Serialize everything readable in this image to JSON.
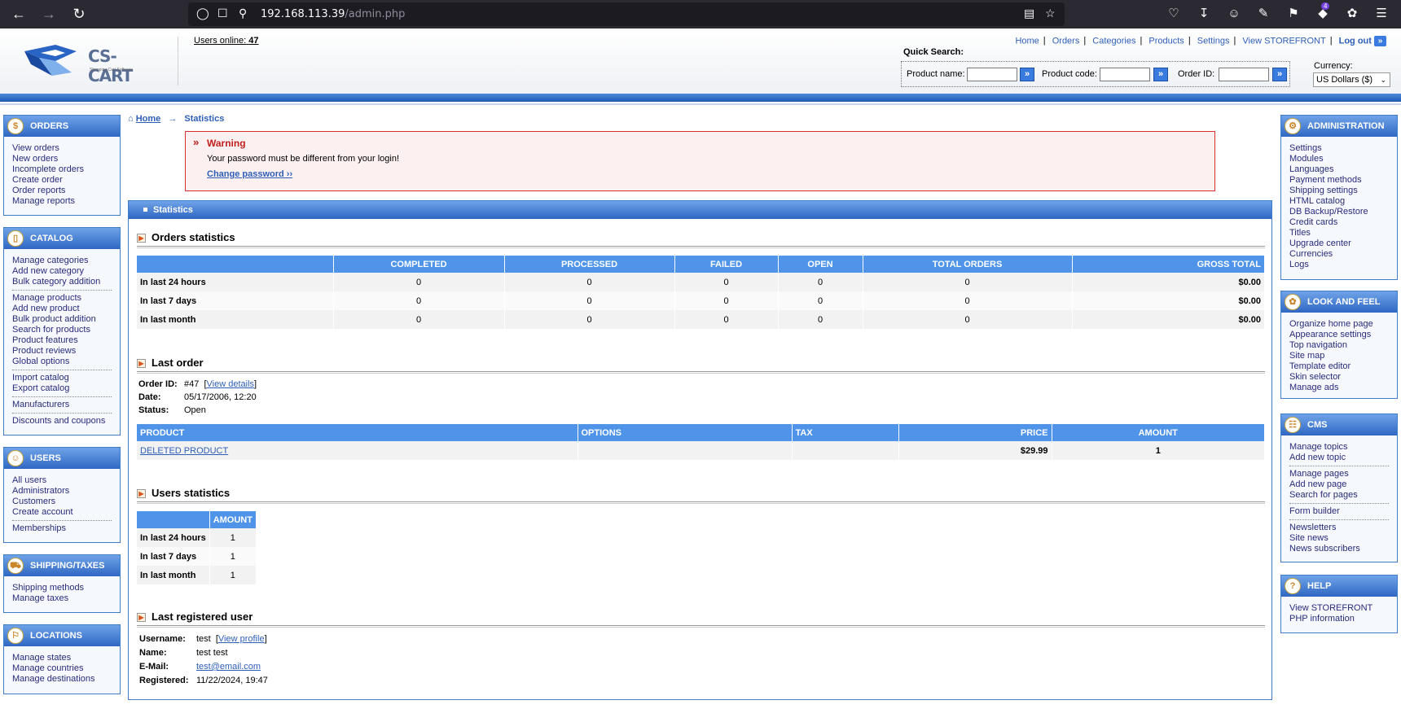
{
  "browser": {
    "url_host": "192.168.113.39",
    "url_path": "/admin.php",
    "extensions_badge": "4"
  },
  "header": {
    "logo_text": "CS-CART",
    "logo_tagline": "Shopping Cart Software",
    "users_online_label": "Users online:",
    "users_online_count": "47",
    "nav": [
      "Home",
      "Orders",
      "Categories",
      "Products",
      "Settings",
      "View STOREFRONT"
    ],
    "logout": "Log out",
    "quick_search": {
      "title": "Quick Search:",
      "product_name_label": "Product name:",
      "product_code_label": "Product code:",
      "order_id_label": "Order ID:"
    },
    "currency_label": "Currency:",
    "currency_value": "US Dollars ($)"
  },
  "left_sidebar": {
    "orders": {
      "title": "ORDERS",
      "items": [
        "View orders",
        "New orders",
        "Incomplete orders",
        "Create order",
        "Order reports",
        "Manage reports"
      ]
    },
    "catalog": {
      "title": "CATALOG",
      "groups": [
        [
          "Manage categories",
          "Add new category",
          "Bulk category addition"
        ],
        [
          "Manage products",
          "Add new product",
          "Bulk product addition",
          "Search for products",
          "Product features",
          "Product reviews",
          "Global options"
        ],
        [
          "Import catalog",
          "Export catalog"
        ],
        [
          "Manufacturers"
        ],
        [
          "Discounts and coupons"
        ]
      ]
    },
    "users": {
      "title": "USERS",
      "groups": [
        [
          "All users",
          "Administrators",
          "Customers",
          "Create account"
        ],
        [
          "Memberships"
        ]
      ]
    },
    "shipping": {
      "title": "SHIPPING/TAXES",
      "items": [
        "Shipping methods",
        "Manage taxes"
      ]
    },
    "locations": {
      "title": "LOCATIONS",
      "items": [
        "Manage states",
        "Manage countries",
        "Manage destinations"
      ]
    }
  },
  "right_sidebar": {
    "administration": {
      "title": "ADMINISTRATION",
      "items": [
        "Settings",
        "Modules",
        "Languages",
        "Payment methods",
        "Shipping settings",
        "HTML catalog",
        "DB Backup/Restore",
        "Credit cards",
        "Titles",
        "Upgrade center",
        "Currencies",
        "Logs"
      ]
    },
    "look_and_feel": {
      "title": "LOOK AND FEEL",
      "items": [
        "Organize home page",
        "Appearance settings",
        "Top navigation",
        "Site map",
        "Template editor",
        "Skin selector",
        "Manage ads"
      ]
    },
    "cms": {
      "title": "CMS",
      "groups": [
        [
          "Manage topics",
          "Add new topic"
        ],
        [
          "Manage pages",
          "Add new page",
          "Search for pages"
        ],
        [
          "Form builder"
        ],
        [
          "Newsletters",
          "Site news",
          "News subscribers"
        ]
      ]
    },
    "help": {
      "title": "HELP",
      "items": [
        "View STOREFRONT",
        "PHP information"
      ]
    }
  },
  "breadcrumb": {
    "home": "Home",
    "current": "Statistics"
  },
  "warning": {
    "title": "Warning",
    "text": "Your password must be different from your login!",
    "link": "Change password ››"
  },
  "statistics": {
    "panel_title": "Statistics",
    "orders_stats": {
      "title": "Orders statistics",
      "columns": [
        "",
        "COMPLETED",
        "PROCESSED",
        "FAILED",
        "OPEN",
        "TOTAL ORDERS",
        "GROSS TOTAL"
      ],
      "rows": [
        [
          "In last 24 hours",
          "0",
          "0",
          "0",
          "0",
          "0",
          "$0.00"
        ],
        [
          "In last 7 days",
          "0",
          "0",
          "0",
          "0",
          "0",
          "$0.00"
        ],
        [
          "In last month",
          "0",
          "0",
          "0",
          "0",
          "0",
          "$0.00"
        ]
      ]
    },
    "last_order": {
      "title": "Last order",
      "order_id_label": "Order ID:",
      "order_id": "#47",
      "view_details": "View details",
      "date_label": "Date:",
      "date": "05/17/2006, 12:20",
      "status_label": "Status:",
      "status": "Open",
      "columns": [
        "PRODUCT",
        "OPTIONS",
        "TAX",
        "PRICE",
        "AMOUNT"
      ],
      "rows": [
        [
          "DELETED PRODUCT",
          "",
          "",
          "$29.99",
          "1"
        ]
      ]
    },
    "users_stats": {
      "title": "Users statistics",
      "columns": [
        "",
        "AMOUNT"
      ],
      "rows": [
        [
          "In last 24 hours",
          "1"
        ],
        [
          "In last 7 days",
          "1"
        ],
        [
          "In last month",
          "1"
        ]
      ]
    },
    "last_user": {
      "title": "Last registered user",
      "username_label": "Username:",
      "username": "test",
      "view_profile": "View profile",
      "name_label": "Name:",
      "name": "test test",
      "email_label": "E-Mail:",
      "email": "test@email.com",
      "registered_label": "Registered:",
      "registered": "11/22/2024, 19:47"
    }
  }
}
